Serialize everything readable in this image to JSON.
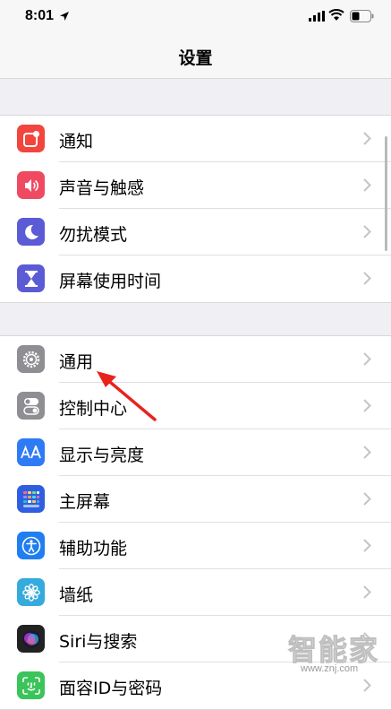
{
  "status_bar": {
    "time": "8:01",
    "icons": [
      "location-arrow-icon",
      "cellular-signal-icon",
      "wifi-icon",
      "battery-icon"
    ]
  },
  "nav": {
    "title": "设置"
  },
  "group1": [
    {
      "label": "通知",
      "icon": "notifications-icon",
      "color": "#f2453d"
    },
    {
      "label": "声音与触感",
      "icon": "sound-icon",
      "color": "#f04a62"
    },
    {
      "label": "勿扰模式",
      "icon": "moon-icon",
      "color": "#5b5bd6"
    },
    {
      "label": "屏幕使用时间",
      "icon": "hourglass-icon",
      "color": "#5b5bd6"
    }
  ],
  "group2": [
    {
      "label": "通用",
      "icon": "gear-icon",
      "color": "#8e8e93"
    },
    {
      "label": "控制中心",
      "icon": "toggles-icon",
      "color": "#8e8e93"
    },
    {
      "label": "显示与亮度",
      "icon": "display-aa-icon",
      "color": "#2f7bf5"
    },
    {
      "label": "主屏幕",
      "icon": "home-screen-grid-icon",
      "color": "#2f5fe0"
    },
    {
      "label": "辅助功能",
      "icon": "accessibility-icon",
      "color": "#1f7ef0"
    },
    {
      "label": "墙纸",
      "icon": "wallpaper-flower-icon",
      "color": "#35aadc"
    },
    {
      "label": "Siri与搜索",
      "icon": "siri-icon",
      "color": "#222222"
    },
    {
      "label": "面容ID与密码",
      "icon": "face-id-icon",
      "color": "#3bc45a"
    }
  ],
  "annotation": {
    "color": "#e8231c"
  },
  "watermark": {
    "text": "智能家",
    "url": "www.znj.com"
  }
}
